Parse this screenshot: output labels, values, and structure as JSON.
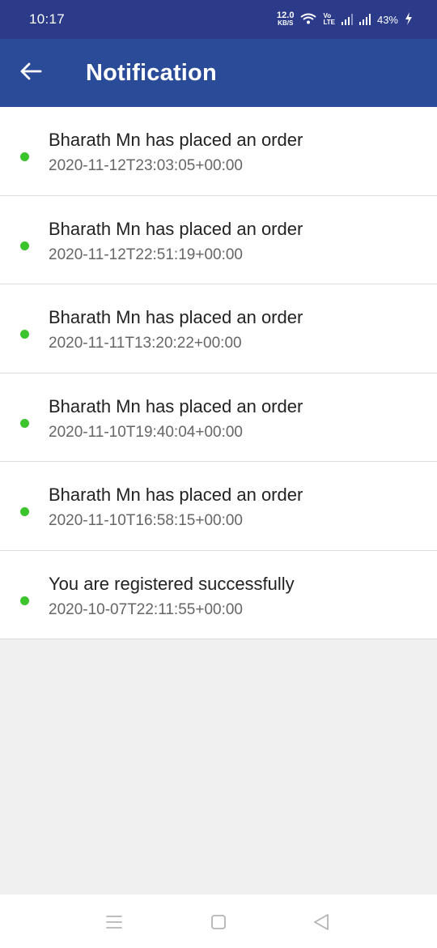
{
  "status_bar": {
    "time": "10:17",
    "net_speed_value": "12.0",
    "net_speed_unit": "KB/S",
    "volte_top": "Vo",
    "volte_bottom": "LTE",
    "battery": "43%"
  },
  "app_bar": {
    "title": "Notification",
    "back_icon": "arrow-left-icon"
  },
  "notifications": [
    {
      "title": "Bharath Mn has placed an order",
      "time": "2020-11-12T23:03:05+00:00"
    },
    {
      "title": "Bharath Mn has placed an order",
      "time": "2020-11-12T22:51:19+00:00"
    },
    {
      "title": "Bharath Mn has placed an order",
      "time": "2020-11-11T13:20:22+00:00"
    },
    {
      "title": "Bharath Mn has placed an order",
      "time": "2020-11-10T19:40:04+00:00"
    },
    {
      "title": "Bharath Mn has placed an order",
      "time": "2020-11-10T16:58:15+00:00"
    },
    {
      "title": "You are registered successfully",
      "time": "2020-10-07T22:11:55+00:00"
    }
  ],
  "colors": {
    "status_bar": "#2b3b8a",
    "app_bar": "#2a4b97",
    "unread_dot": "#3cc42c",
    "background": "#f0f0f0"
  },
  "nav_bar": {
    "icons": [
      "menu-icon",
      "home-icon",
      "back-triangle-icon"
    ]
  }
}
